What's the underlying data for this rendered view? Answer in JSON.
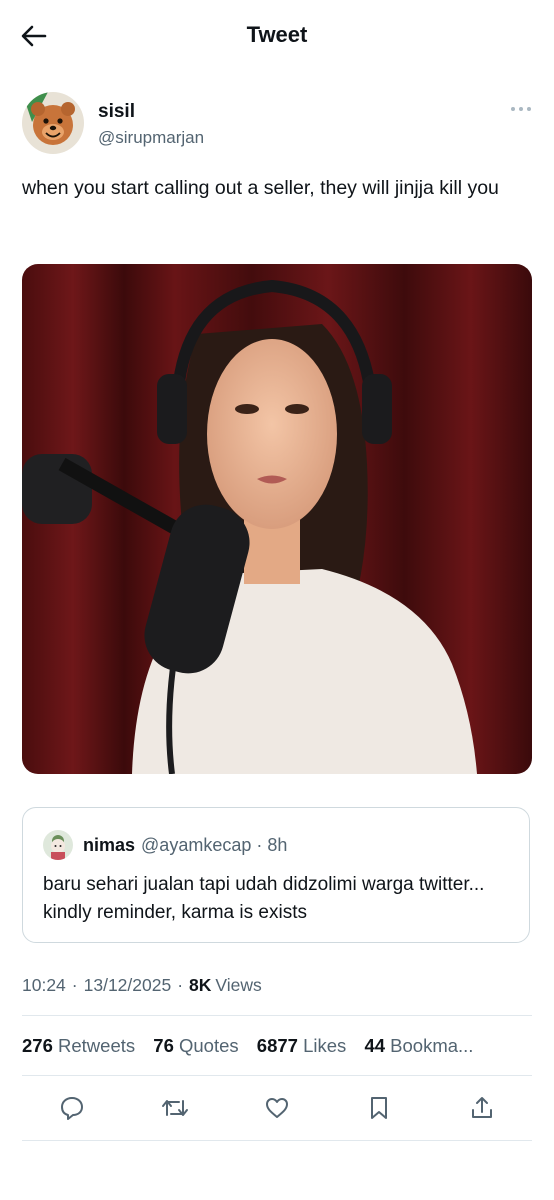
{
  "header": {
    "title": "Tweet"
  },
  "author": {
    "name": "sisil",
    "handle": "@sirupmarjan"
  },
  "tweet": {
    "text": "when you start calling out a seller, they will jinjja kill you"
  },
  "quote": {
    "name": "nimas",
    "handle": "@ayamkecap",
    "separator": "·",
    "time": "8h",
    "text": "baru sehari jualan tapi udah didzolimi warga twitter... kindly reminder, karma is exists"
  },
  "meta": {
    "time": "10:24",
    "dot1": "·",
    "date": "13/12/2025",
    "dot2": "·",
    "views_count": "8K",
    "views_label": "Views"
  },
  "stats": {
    "retweets_count": "276",
    "retweets_label": "Retweets",
    "quotes_count": "76",
    "quotes_label": "Quotes",
    "likes_count": "6877",
    "likes_label": "Likes",
    "bookmarks_count": "44",
    "bookmarks_label": "Bookma..."
  },
  "icons": {
    "back": "arrow-left-icon",
    "more": "more-horizontal-icon",
    "reply": "reply-icon",
    "retweet": "retweet-icon",
    "like": "heart-icon",
    "bookmark": "bookmark-icon",
    "share": "share-icon"
  },
  "colors": {
    "text": "#0f1419",
    "secondary": "#536471",
    "border": "#cfd9de",
    "divider": "#e1e8ed"
  }
}
